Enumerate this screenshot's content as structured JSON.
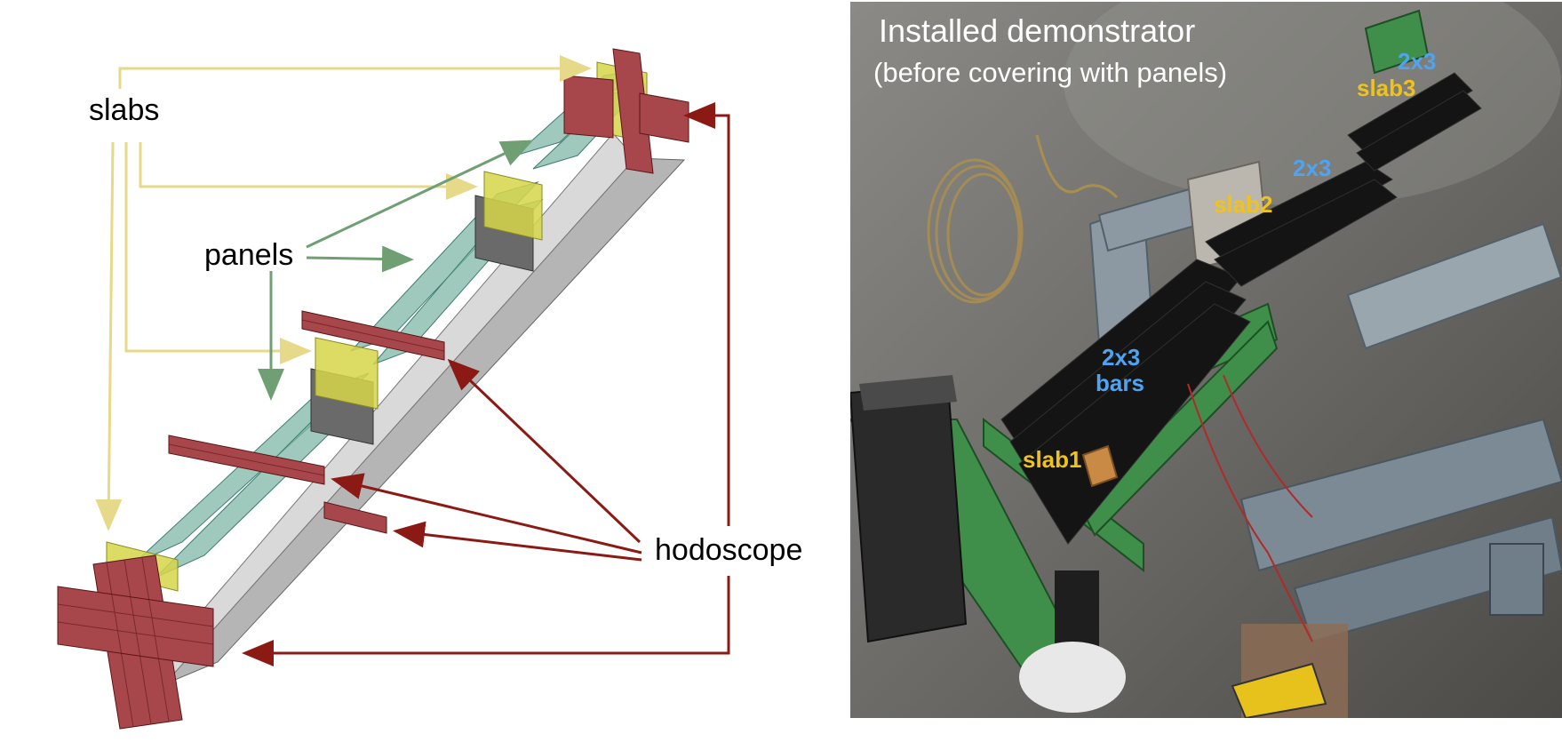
{
  "diagram": {
    "labels": {
      "slabs": "slabs",
      "panels": "panels",
      "hodoscope": "hodoscope"
    },
    "colors": {
      "slab_arrow": "#e6d98a",
      "panel_arrow": "#6f9f73",
      "hodoscope_arrow": "#8b1a14",
      "hodoscope_bar": "#a8474b",
      "slab_plate": "#d6d64a",
      "detector_bar": "#7fb7a6"
    }
  },
  "photo": {
    "title_line1": "Installed demonstrator",
    "title_line2": "(before covering with panels)",
    "tags": {
      "slab1": "slab1",
      "slab2": "slab2",
      "slab3": "slab3",
      "bars_2x3_top": "2x3",
      "bars_2x3_mid": "2x3",
      "bars_2x3_low": "2x3",
      "bars_word": "bars"
    },
    "colors": {
      "slab_tag": "#f0c21c",
      "bars_tag": "#4fa3f0"
    }
  }
}
